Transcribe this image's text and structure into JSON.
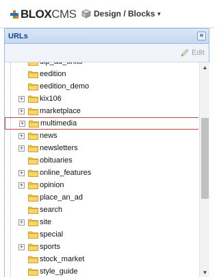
{
  "header": {
    "logo_bold": "BLOX",
    "logo_light": "CMS",
    "menu_label": "Design / Blocks"
  },
  "panel": {
    "title": "URLs",
    "edit_label": "Edit"
  },
  "tree": {
    "items": [
      {
        "label": "dlp_ad_units",
        "expandable": false
      },
      {
        "label": "eedition",
        "expandable": false
      },
      {
        "label": "eedition_demo",
        "expandable": false
      },
      {
        "label": "kix106",
        "expandable": true
      },
      {
        "label": "marketplace",
        "expandable": true
      },
      {
        "label": "multimedia",
        "expandable": true,
        "selected": true
      },
      {
        "label": "news",
        "expandable": true
      },
      {
        "label": "newsletters",
        "expandable": true
      },
      {
        "label": "obituaries",
        "expandable": false
      },
      {
        "label": "online_features",
        "expandable": true
      },
      {
        "label": "opinion",
        "expandable": true
      },
      {
        "label": "place_an_ad",
        "expandable": false
      },
      {
        "label": "search",
        "expandable": false
      },
      {
        "label": "site",
        "expandable": true
      },
      {
        "label": "special",
        "expandable": false
      },
      {
        "label": "sports",
        "expandable": true
      },
      {
        "label": "stock_market",
        "expandable": false
      },
      {
        "label": "style_guide",
        "expandable": false
      }
    ]
  },
  "colors": {
    "panel_header": "#c6d8ef",
    "panel_title": "#15428b",
    "folder": "#f5c543",
    "selected_border": "#b44"
  },
  "icons": {
    "collapse": "double-chevron-left-icon",
    "edit": "pencil-icon",
    "menu": "cube-icon",
    "folder": "folder-icon",
    "expander": "plus-box-icon"
  }
}
